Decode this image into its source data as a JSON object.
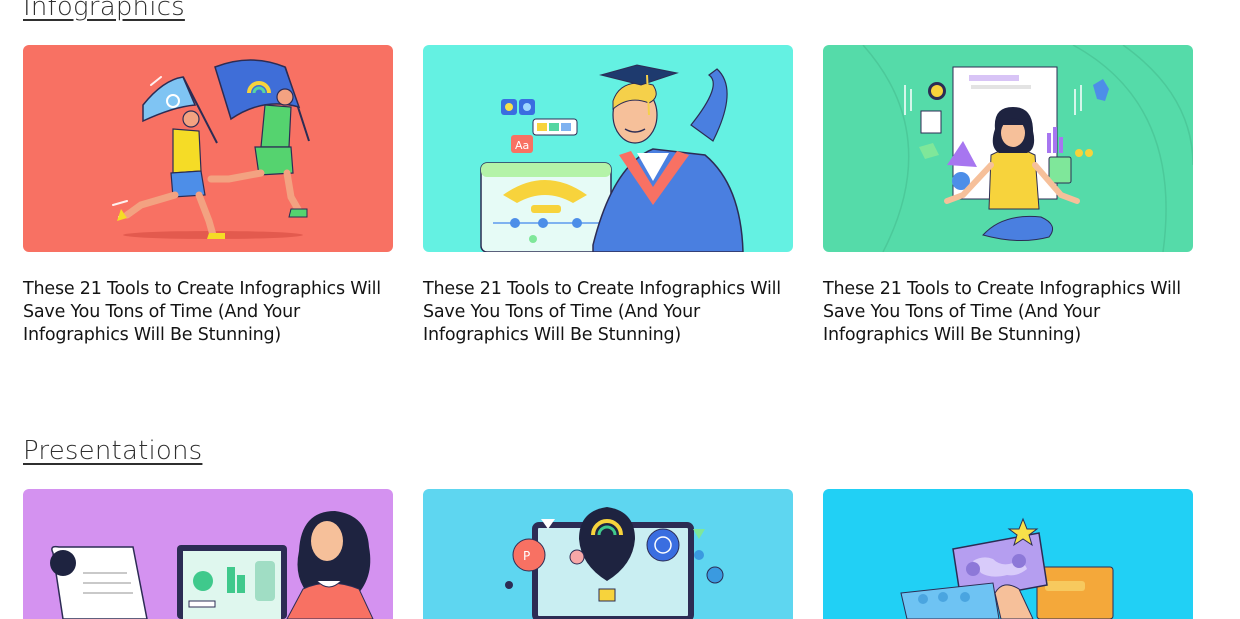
{
  "sections": [
    {
      "title": "Infographics",
      "cards": [
        {
          "title": "These 21 Tools to Create Infographics Will Save You Tons of Time (And Your Infographics Will Be Stunning)",
          "bg": "#f87163",
          "illustration": "runners-with-flags"
        },
        {
          "title": "These 21 Tools to Create Infographics Will Save You Tons of Time (And Your Infographics Will Be Stunning)",
          "bg": "#64f1e2",
          "illustration": "graduate-with-charts"
        },
        {
          "title": "These 21 Tools to Create Infographics Will Save You Tons of Time (And Your Infographics Will Be Stunning)",
          "bg": "#55dba9",
          "illustration": "meditating-woman-with-docs"
        }
      ]
    },
    {
      "title": "Presentations",
      "cards": [
        {
          "bg": "#d492f0",
          "illustration": "woman-with-laptop-dashboard"
        },
        {
          "bg": "#5ed6f0",
          "illustration": "hot-air-balloons-screen"
        },
        {
          "bg": "#21d0f5",
          "illustration": "map-cards-with-star"
        }
      ]
    }
  ]
}
